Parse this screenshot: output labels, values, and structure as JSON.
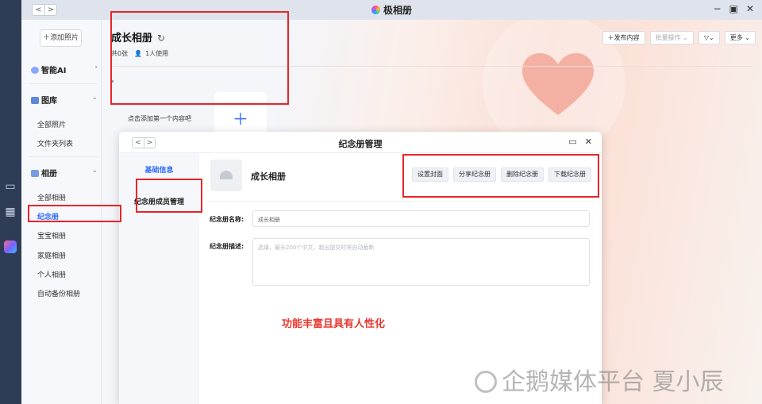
{
  "app": {
    "title": "极相册"
  },
  "sidebar": {
    "add_photo": "＋添加照片",
    "ai": "智能AI",
    "gallery": "图库",
    "gallery_items": [
      "全部照片",
      "文件夹列表"
    ],
    "albums": "相册",
    "album_items": [
      "全部相册",
      "纪念册",
      "宝宝相册",
      "家庭相册",
      "个人相册",
      "自动备份相册"
    ]
  },
  "header": {
    "title": "成长相册",
    "count": "共0张",
    "users": "1人使用",
    "publish": "＋发布内容",
    "batch": "批量操作 ⌄",
    "filter": "⌄",
    "more": "更多 ⌄"
  },
  "empty_tip": "点击添加第一个内容吧",
  "dialog": {
    "title": "纪念册管理",
    "tabs": [
      "基础信息",
      "纪念册成员管理"
    ],
    "album_name": "成长相册",
    "actions": [
      "设置封面",
      "分享纪念册",
      "删除纪念册",
      "下载纪念册"
    ],
    "name_label": "纪念册名称:",
    "name_value": "成长相册",
    "desc_label": "纪念册描述:",
    "desc_placeholder": "选填，最长200个中文，超出提交时将自动截断"
  },
  "annotation": "功能丰富且具有人性化",
  "watermark": "企鹅媒体平台 夏小辰",
  "colors": {
    "accent": "#2f6bff",
    "highlight": "#e8242a"
  }
}
